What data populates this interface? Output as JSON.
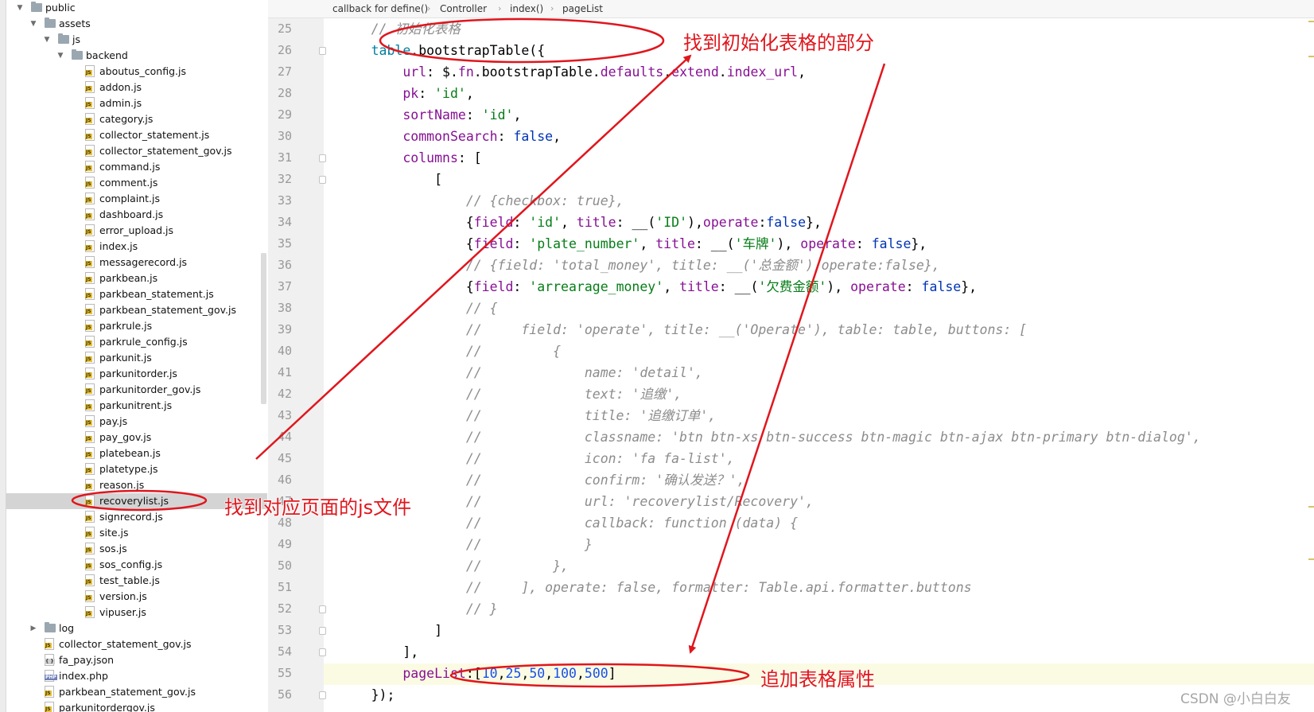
{
  "project_tree": {
    "items": [
      {
        "label": "public",
        "kind": "folder",
        "depth": 1,
        "expanded": true
      },
      {
        "label": "assets",
        "kind": "folder",
        "depth": 2,
        "expanded": true
      },
      {
        "label": "js",
        "kind": "folder",
        "depth": 3,
        "expanded": true
      },
      {
        "label": "backend",
        "kind": "folder",
        "depth": 4,
        "expanded": true
      },
      {
        "label": "aboutus_config.js",
        "kind": "js",
        "depth": 5
      },
      {
        "label": "addon.js",
        "kind": "js",
        "depth": 5
      },
      {
        "label": "admin.js",
        "kind": "js",
        "depth": 5
      },
      {
        "label": "category.js",
        "kind": "js",
        "depth": 5
      },
      {
        "label": "collector_statement.js",
        "kind": "js",
        "depth": 5
      },
      {
        "label": "collector_statement_gov.js",
        "kind": "js",
        "depth": 5
      },
      {
        "label": "command.js",
        "kind": "js",
        "depth": 5
      },
      {
        "label": "comment.js",
        "kind": "js",
        "depth": 5
      },
      {
        "label": "complaint.js",
        "kind": "js",
        "depth": 5
      },
      {
        "label": "dashboard.js",
        "kind": "js",
        "depth": 5
      },
      {
        "label": "error_upload.js",
        "kind": "js",
        "depth": 5
      },
      {
        "label": "index.js",
        "kind": "js",
        "depth": 5
      },
      {
        "label": "messagerecord.js",
        "kind": "js",
        "depth": 5
      },
      {
        "label": "parkbean.js",
        "kind": "js",
        "depth": 5
      },
      {
        "label": "parkbean_statement.js",
        "kind": "js",
        "depth": 5
      },
      {
        "label": "parkbean_statement_gov.js",
        "kind": "js",
        "depth": 5
      },
      {
        "label": "parkrule.js",
        "kind": "js",
        "depth": 5
      },
      {
        "label": "parkrule_config.js",
        "kind": "js",
        "depth": 5
      },
      {
        "label": "parkunit.js",
        "kind": "js",
        "depth": 5
      },
      {
        "label": "parkunitorder.js",
        "kind": "js",
        "depth": 5
      },
      {
        "label": "parkunitorder_gov.js",
        "kind": "js",
        "depth": 5
      },
      {
        "label": "parkunitrent.js",
        "kind": "js",
        "depth": 5
      },
      {
        "label": "pay.js",
        "kind": "js",
        "depth": 5
      },
      {
        "label": "pay_gov.js",
        "kind": "js",
        "depth": 5
      },
      {
        "label": "platebean.js",
        "kind": "js",
        "depth": 5
      },
      {
        "label": "platetype.js",
        "kind": "js",
        "depth": 5
      },
      {
        "label": "reason.js",
        "kind": "js",
        "depth": 5
      },
      {
        "label": "recoverylist.js",
        "kind": "js",
        "depth": 5,
        "selected": true
      },
      {
        "label": "signrecord.js",
        "kind": "js",
        "depth": 5
      },
      {
        "label": "site.js",
        "kind": "js",
        "depth": 5
      },
      {
        "label": "sos.js",
        "kind": "js",
        "depth": 5
      },
      {
        "label": "sos_config.js",
        "kind": "js",
        "depth": 5
      },
      {
        "label": "test_table.js",
        "kind": "js",
        "depth": 5
      },
      {
        "label": "version.js",
        "kind": "js",
        "depth": 5
      },
      {
        "label": "vipuser.js",
        "kind": "js",
        "depth": 5
      },
      {
        "label": "log",
        "kind": "folder",
        "depth": 2,
        "expanded": false
      },
      {
        "label": "collector_statement_gov.js",
        "kind": "js",
        "depth": 2
      },
      {
        "label": "fa_pay.json",
        "kind": "json",
        "depth": 2
      },
      {
        "label": "index.php",
        "kind": "php",
        "depth": 2
      },
      {
        "label": "parkbean_statement_gov.js",
        "kind": "js",
        "depth": 2
      },
      {
        "label": "parkunitordergov.js",
        "kind": "js",
        "depth": 2
      }
    ]
  },
  "breadcrumb": {
    "items": [
      "callback for define()",
      "Controller",
      "index()",
      "pageList"
    ]
  },
  "editor": {
    "lines": [
      {
        "num": "25",
        "fold": false,
        "tokens": [
          [
            "      ",
            ""
          ],
          [
            "// 初始化表格",
            "cmt"
          ]
        ]
      },
      {
        "num": "26",
        "fold": true,
        "tokens": [
          [
            "      ",
            ""
          ],
          [
            "table",
            "var"
          ],
          [
            ".bootstrapTable({",
            ""
          ]
        ]
      },
      {
        "num": "27",
        "fold": false,
        "tokens": [
          [
            "          ",
            ""
          ],
          [
            "url",
            "prop"
          ],
          [
            ": $.",
            ""
          ],
          [
            "fn",
            "prop"
          ],
          [
            ".bootstrapTable.",
            ""
          ],
          [
            "defaults",
            "prop"
          ],
          [
            ".",
            ""
          ],
          [
            "extend",
            "prop"
          ],
          [
            ".",
            ""
          ],
          [
            "index_url",
            "prop"
          ],
          [
            ",",
            ""
          ]
        ]
      },
      {
        "num": "28",
        "fold": false,
        "tokens": [
          [
            "          ",
            ""
          ],
          [
            "pk",
            "prop"
          ],
          [
            ": ",
            ""
          ],
          [
            "'id'",
            "str"
          ],
          [
            ",",
            ""
          ]
        ]
      },
      {
        "num": "29",
        "fold": false,
        "tokens": [
          [
            "          ",
            ""
          ],
          [
            "sortName",
            "prop"
          ],
          [
            ": ",
            ""
          ],
          [
            "'id'",
            "str"
          ],
          [
            ",",
            ""
          ]
        ]
      },
      {
        "num": "30",
        "fold": false,
        "tokens": [
          [
            "          ",
            ""
          ],
          [
            "commonSearch",
            "prop"
          ],
          [
            ": ",
            ""
          ],
          [
            "false",
            "kw"
          ],
          [
            ",",
            ""
          ]
        ]
      },
      {
        "num": "31",
        "fold": true,
        "tokens": [
          [
            "          ",
            ""
          ],
          [
            "columns",
            "prop"
          ],
          [
            ": [",
            ""
          ]
        ]
      },
      {
        "num": "32",
        "fold": true,
        "tokens": [
          [
            "              [",
            ""
          ]
        ]
      },
      {
        "num": "33",
        "fold": false,
        "tokens": [
          [
            "                  ",
            ""
          ],
          [
            "// {checkbox: true},",
            "cmt"
          ]
        ]
      },
      {
        "num": "34",
        "fold": false,
        "tokens": [
          [
            "                  {",
            ""
          ],
          [
            "field",
            "prop"
          ],
          [
            ": ",
            ""
          ],
          [
            "'id'",
            "str"
          ],
          [
            ", ",
            ""
          ],
          [
            "title",
            "prop"
          ],
          [
            ": __(",
            ""
          ],
          [
            "'ID'",
            "str"
          ],
          [
            "),",
            ""
          ],
          [
            "operate",
            "prop"
          ],
          [
            ":",
            ""
          ],
          [
            "false",
            "kw"
          ],
          [
            "},",
            ""
          ]
        ]
      },
      {
        "num": "35",
        "fold": false,
        "tokens": [
          [
            "                  {",
            ""
          ],
          [
            "field",
            "prop"
          ],
          [
            ": ",
            ""
          ],
          [
            "'plate_number'",
            "str"
          ],
          [
            ", ",
            ""
          ],
          [
            "title",
            "prop"
          ],
          [
            ": __(",
            ""
          ],
          [
            "'车牌'",
            "str"
          ],
          [
            "), ",
            ""
          ],
          [
            "operate",
            "prop"
          ],
          [
            ": ",
            ""
          ],
          [
            "false",
            "kw"
          ],
          [
            "},",
            ""
          ]
        ]
      },
      {
        "num": "36",
        "fold": false,
        "tokens": [
          [
            "                  ",
            ""
          ],
          [
            "// {field: 'total_money', title: __('总金额'),operate:false},",
            "cmt"
          ]
        ]
      },
      {
        "num": "37",
        "fold": false,
        "tokens": [
          [
            "                  {",
            ""
          ],
          [
            "field",
            "prop"
          ],
          [
            ": ",
            ""
          ],
          [
            "'arrearage_money'",
            "str"
          ],
          [
            ", ",
            ""
          ],
          [
            "title",
            "prop"
          ],
          [
            ": __(",
            ""
          ],
          [
            "'欠费金额'",
            "str"
          ],
          [
            "), ",
            ""
          ],
          [
            "operate",
            "prop"
          ],
          [
            ": ",
            ""
          ],
          [
            "false",
            "kw"
          ],
          [
            "},",
            ""
          ]
        ]
      },
      {
        "num": "38",
        "fold": false,
        "tokens": [
          [
            "                  ",
            ""
          ],
          [
            "// {",
            "cmt"
          ]
        ]
      },
      {
        "num": "39",
        "fold": false,
        "tokens": [
          [
            "                  ",
            ""
          ],
          [
            "//     field: 'operate', title: __('Operate'), table: table, buttons: [",
            "cmt"
          ]
        ]
      },
      {
        "num": "40",
        "fold": false,
        "tokens": [
          [
            "                  ",
            ""
          ],
          [
            "//         {",
            "cmt"
          ]
        ]
      },
      {
        "num": "41",
        "fold": false,
        "tokens": [
          [
            "                  ",
            ""
          ],
          [
            "//             name: 'detail',",
            "cmt"
          ]
        ]
      },
      {
        "num": "42",
        "fold": false,
        "tokens": [
          [
            "                  ",
            ""
          ],
          [
            "//             text: '追缴',",
            "cmt"
          ]
        ]
      },
      {
        "num": "43",
        "fold": false,
        "tokens": [
          [
            "                  ",
            ""
          ],
          [
            "//             title: '追缴订单',",
            "cmt"
          ]
        ]
      },
      {
        "num": "44",
        "fold": false,
        "tokens": [
          [
            "                  ",
            ""
          ],
          [
            "//             classname: 'btn btn-xs btn-success btn-magic btn-ajax btn-primary btn-dialog',",
            "cmt"
          ]
        ]
      },
      {
        "num": "45",
        "fold": false,
        "tokens": [
          [
            "                  ",
            ""
          ],
          [
            "//             icon: 'fa fa-list',",
            "cmt"
          ]
        ]
      },
      {
        "num": "46",
        "fold": false,
        "tokens": [
          [
            "                  ",
            ""
          ],
          [
            "//             confirm: '确认发送？',",
            "cmt"
          ]
        ]
      },
      {
        "num": "47",
        "fold": false,
        "tokens": [
          [
            "                  ",
            ""
          ],
          [
            "//             url: 'recoverylist/Recovery',",
            "cmt"
          ]
        ]
      },
      {
        "num": "48",
        "fold": false,
        "tokens": [
          [
            "                  ",
            ""
          ],
          [
            "//             callback: function (data) {",
            "cmt"
          ]
        ]
      },
      {
        "num": "49",
        "fold": false,
        "tokens": [
          [
            "                  ",
            ""
          ],
          [
            "//             }",
            "cmt"
          ]
        ]
      },
      {
        "num": "50",
        "fold": false,
        "tokens": [
          [
            "                  ",
            ""
          ],
          [
            "//         },",
            "cmt"
          ]
        ]
      },
      {
        "num": "51",
        "fold": false,
        "tokens": [
          [
            "                  ",
            ""
          ],
          [
            "//     ], operate: false, formatter: Table.api.formatter.buttons",
            "cmt"
          ]
        ]
      },
      {
        "num": "52",
        "fold": true,
        "tokens": [
          [
            "                  ",
            ""
          ],
          [
            "// }",
            "cmt"
          ]
        ]
      },
      {
        "num": "53",
        "fold": true,
        "tokens": [
          [
            "              ]",
            ""
          ]
        ]
      },
      {
        "num": "54",
        "fold": true,
        "tokens": [
          [
            "          ],",
            ""
          ]
        ]
      },
      {
        "num": "55",
        "fold": false,
        "tokens": [
          [
            "          ",
            ""
          ],
          [
            "pageList",
            "prop"
          ],
          [
            ":[",
            ""
          ],
          [
            "10",
            "num"
          ],
          [
            ",",
            ""
          ],
          [
            "25",
            "num"
          ],
          [
            ",",
            ""
          ],
          [
            "50",
            "num"
          ],
          [
            ",",
            ""
          ],
          [
            "100",
            "num"
          ],
          [
            ",",
            ""
          ],
          [
            "500",
            "num"
          ],
          [
            "]",
            ""
          ]
        ]
      },
      {
        "num": "56",
        "fold": true,
        "tokens": [
          [
            "      });",
            ""
          ]
        ]
      }
    ]
  },
  "annotations": {
    "color": "#e0161d",
    "init_table_label": "找到初始化表格的部分",
    "find_js_label": "找到对应页面的js文件",
    "add_attr_label": "追加表格属性"
  },
  "watermark": "CSDN @小白白友",
  "colors": {
    "keyword": "#0033b3",
    "property": "#871094",
    "string": "#067d17",
    "comment": "#8c8c8c",
    "number": "#1750eb",
    "selection": "#d4d4d4"
  }
}
